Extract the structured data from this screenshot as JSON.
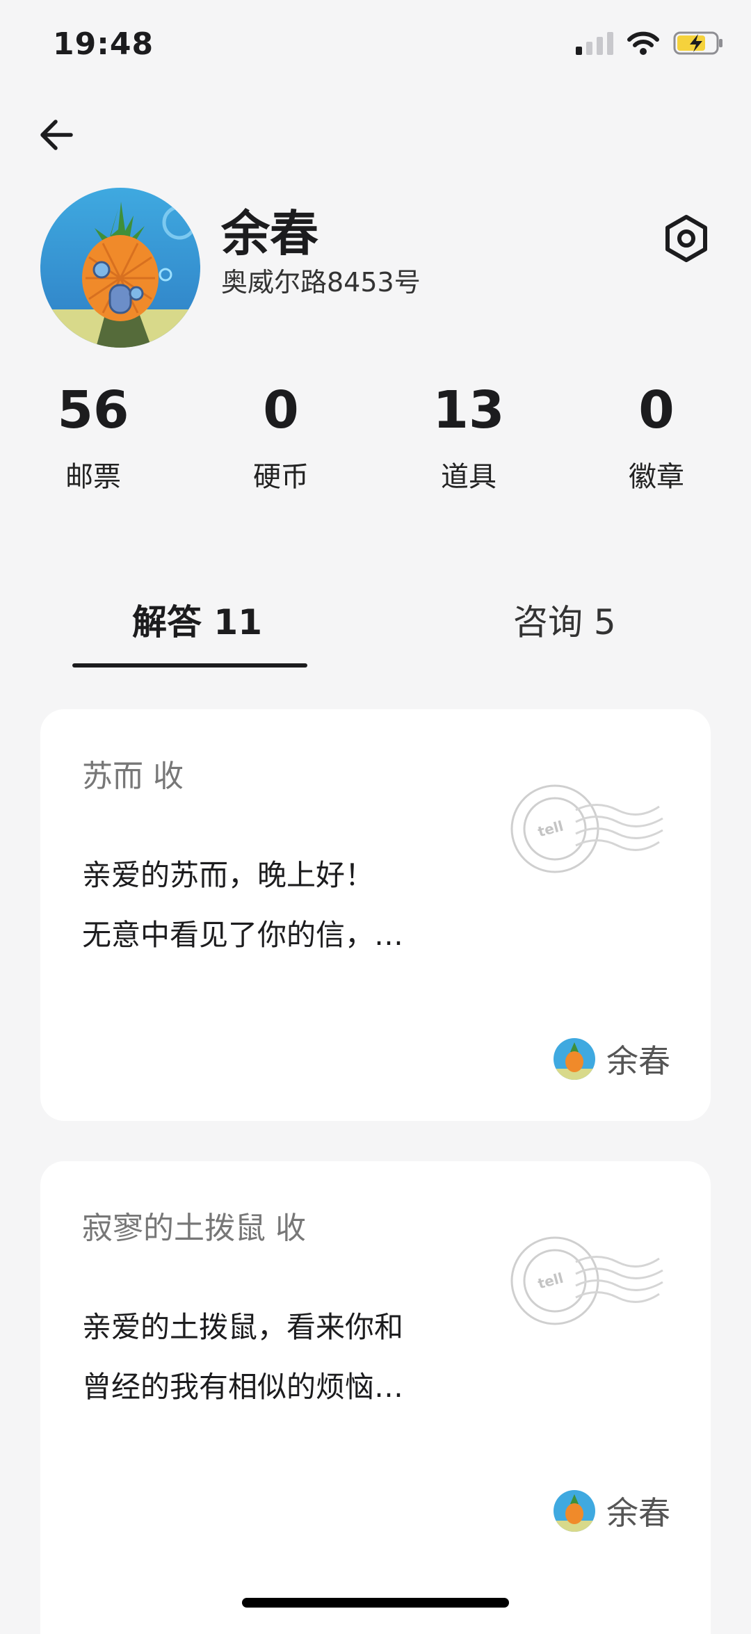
{
  "status": {
    "time": "19:48"
  },
  "profile": {
    "name": "余春",
    "address": "奥威尔路8453号"
  },
  "stats": [
    {
      "value": "56",
      "label": "邮票"
    },
    {
      "value": "0",
      "label": "硬币"
    },
    {
      "value": "13",
      "label": "道具"
    },
    {
      "value": "0",
      "label": "徽章"
    }
  ],
  "tabs": [
    {
      "label": "解答 11",
      "selected": true
    },
    {
      "label": "咨询 5",
      "selected": false
    }
  ],
  "letters": [
    {
      "to": "苏而 收",
      "line1": "亲爱的苏而，晚上好！",
      "line2": "无意中看见了你的信，…",
      "author": "余春"
    },
    {
      "to": "寂寥的土拨鼠 收",
      "line1": "亲爱的土拨鼠，看来你和",
      "line2": "曾经的我有相似的烦恼…",
      "author": "余春"
    }
  ],
  "postmark_text": "tell",
  "icons": {
    "back": "back-arrow-icon",
    "settings": "hexagon-settings-icon",
    "battery": "battery-charging-icon",
    "wifi": "wifi-icon",
    "signal": "cellular-signal-icon"
  },
  "colors": {
    "background": "#f5f5f6",
    "card": "#ffffff",
    "text": "#1c1c1e",
    "battery": "#f5d23c"
  }
}
